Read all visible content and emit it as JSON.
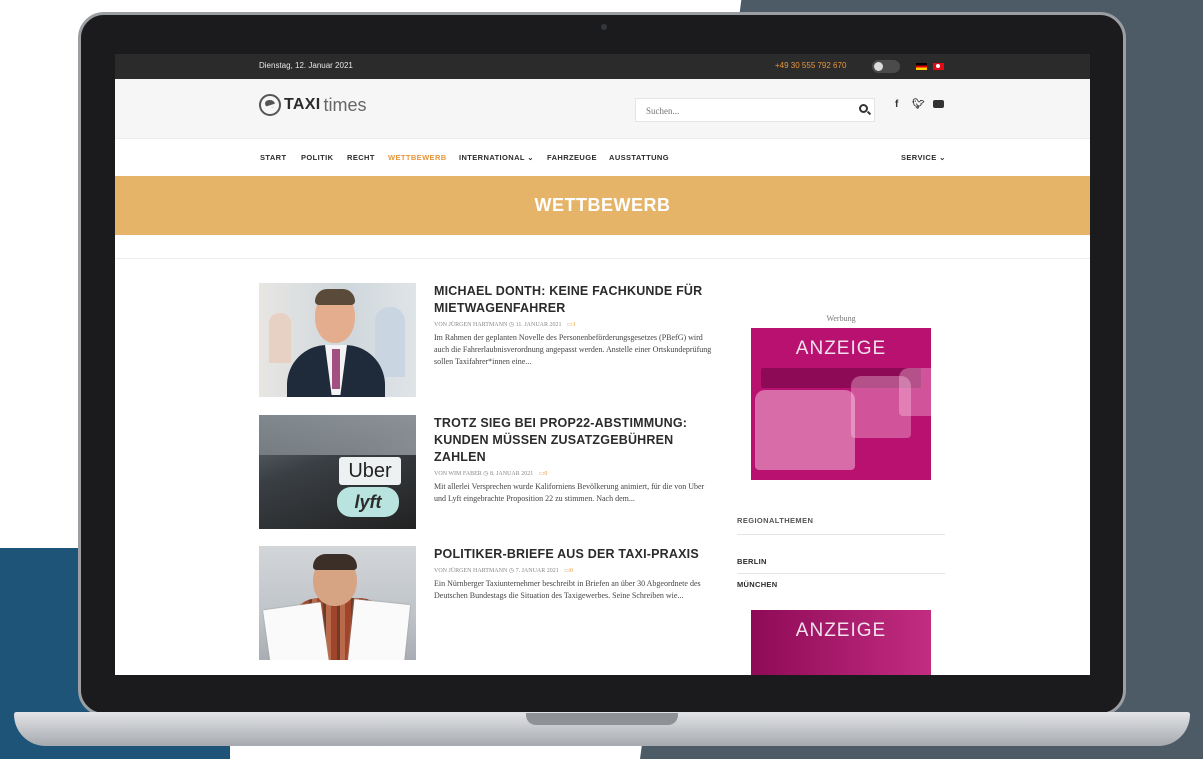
{
  "topbar": {
    "date": "Dienstag, 12. Januar 2021",
    "phone": "+49 30 555 792 670"
  },
  "header": {
    "logo_bold": "TAXI",
    "logo_light": "times",
    "search_placeholder": "Suchen..."
  },
  "nav": {
    "items": [
      {
        "label": "START"
      },
      {
        "label": "POLITIK"
      },
      {
        "label": "RECHT"
      },
      {
        "label": "WETTBEWERB"
      },
      {
        "label": "INTERNATIONAL ⌄"
      },
      {
        "label": "FAHRZEUGE"
      },
      {
        "label": "AUSSTATTUNG"
      }
    ],
    "service": "SERVICE ⌄"
  },
  "category": {
    "title": "WETTBEWERB"
  },
  "articles": [
    {
      "title": "MICHAEL DONTH: KEINE FACHKUNDE FÜR MIETWAGENFAHRER",
      "author": "VON JÜRGEN HARTMANN",
      "date": "11. JANUAR 2021",
      "comments": "1",
      "excerpt": "Im Rahmen der geplanten Novelle des Personenbeförderungsgesetzes (PBefG) wird auch die Fahrerlaubnisverordnung angepasst werden. Anstelle einer Ortskundeprüfung sollen Taxifahrer*innen eine..."
    },
    {
      "title": "TROTZ SIEG BEI PROP22-ABSTIMMUNG: KUNDEN MÜSSEN ZUSATZGEBÜHREN ZAHLEN",
      "author": "VON WIM FABER",
      "date": "8. JANUAR 2021",
      "comments": "0",
      "excerpt": "Mit allerlei Versprechen wurde Kaliforniens Bevölkerung animiert, für die von Uber und Lyft eingebrachte Proposition 22 zu stimmen. Nach dem...",
      "thumb_text_1": "Uber",
      "thumb_text_2": "lyft"
    },
    {
      "title": "POLITIKER-BRIEFE AUS DER TAXI-PRAXIS",
      "author": "VON JÜRGEN HARTMANN",
      "date": "7. JANUAR 2021",
      "comments": "0",
      "excerpt": "Ein Nürnberger Taxiunternehmer beschreibt in Briefen an über 30 Abgeordnete des Deutschen Bundestags die Situation des Taxigewerbes. Seine Schreiben wie..."
    }
  ],
  "sidebar": {
    "ad_label": "Werbung",
    "ad_text": "ANZEIGE",
    "heading": "REGIONALTHEMEN",
    "links": [
      "BERLIN",
      "MÜNCHEN"
    ]
  },
  "colors": {
    "accent": "#e8963a",
    "band": "#e6b469",
    "ad": "#b8116f",
    "topbar": "#2b2b2b"
  },
  "icons": {
    "search": "search-icon",
    "facebook": "facebook-icon",
    "twitter": "twitter-icon",
    "youtube": "youtube-icon",
    "theme_toggle": "theme-toggle-icon",
    "flag_de": "flag-de-icon",
    "flag_tr": "flag-tr-icon",
    "comment": "comment-icon",
    "clock": "clock-icon"
  }
}
